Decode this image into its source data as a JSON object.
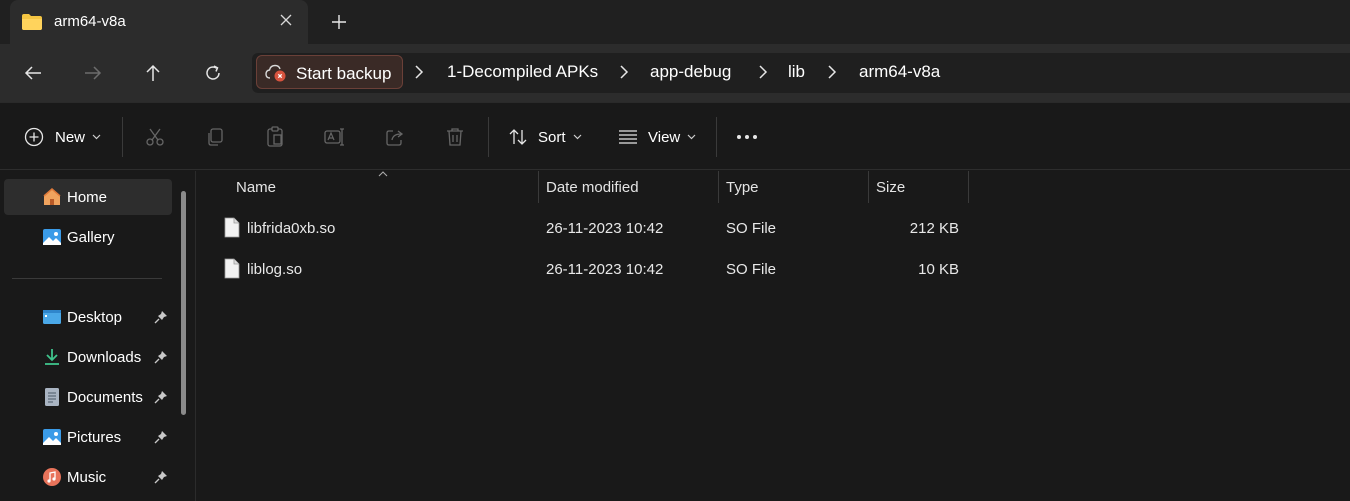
{
  "tab": {
    "title": "arm64-v8a",
    "close_icon": "close-icon",
    "new_tab_icon": "plus-icon"
  },
  "nav": {
    "back_icon": "arrow-left-icon",
    "forward_icon": "arrow-right-icon",
    "up_icon": "arrow-up-icon",
    "refresh_icon": "refresh-icon"
  },
  "address": {
    "backup_label": "Start backup",
    "breadcrumbs": [
      "1-Decompiled APKs",
      "app-debug",
      "lib",
      "arm64-v8a"
    ]
  },
  "toolbar": {
    "new_label": "New",
    "sort_label": "Sort",
    "view_label": "View",
    "icons": [
      "add-circle-icon",
      "cut-icon",
      "copy-icon",
      "paste-icon",
      "rename-icon",
      "share-icon",
      "delete-icon",
      "sort-icon",
      "view-icon",
      "more-icon"
    ]
  },
  "sidebar": {
    "items": [
      {
        "label": "Home",
        "icon": "home-icon",
        "pinned": false,
        "active": true
      },
      {
        "label": "Gallery",
        "icon": "gallery-icon",
        "pinned": false,
        "active": false
      },
      {
        "label": "Desktop",
        "icon": "desktop-icon",
        "pinned": true,
        "active": false
      },
      {
        "label": "Downloads",
        "icon": "download-icon",
        "pinned": true,
        "active": false
      },
      {
        "label": "Documents",
        "icon": "documents-icon",
        "pinned": true,
        "active": false
      },
      {
        "label": "Pictures",
        "icon": "pictures-icon",
        "pinned": true,
        "active": false
      },
      {
        "label": "Music",
        "icon": "music-icon",
        "pinned": true,
        "active": false
      }
    ]
  },
  "file_list": {
    "columns": [
      "Name",
      "Date modified",
      "Type",
      "Size"
    ],
    "rows": [
      {
        "name": "libfrida0xb.so",
        "date": "26-11-2023 10:42",
        "type": "SO File",
        "size": "212 KB"
      },
      {
        "name": "liblog.so",
        "date": "26-11-2023 10:42",
        "type": "SO File",
        "size": "10 KB"
      }
    ]
  },
  "colors": {
    "accent": "#4cc2ff",
    "background": "#191919",
    "backup_chip": "#3a2a26",
    "folder": "#f4c542"
  }
}
